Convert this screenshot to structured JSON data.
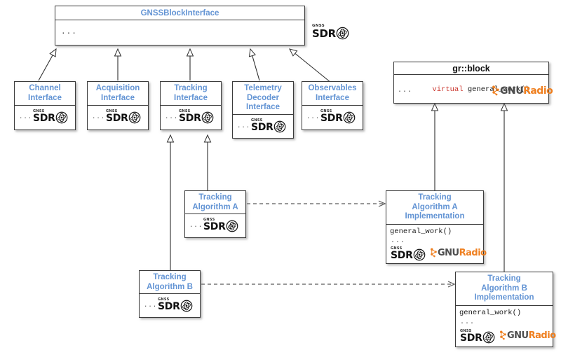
{
  "diagram": {
    "title_color": "#6394d4",
    "keyword_color": "#cc3b33",
    "gnuradio_accent": "#ef7f1f",
    "background": "#ffffff"
  },
  "logos": {
    "gnss_sdr": {
      "top_text": "GNSS",
      "main_text": "SDR",
      "name": "gnss-sdr-logo"
    },
    "gnuradio": {
      "part1": "GNU",
      "part2": "Radio",
      "name": "gnuradio-logo"
    }
  },
  "nodes": {
    "gnss_block_interface": {
      "title": "GNSSBlockInterface",
      "body_dots": "..."
    },
    "channel_interface": {
      "title": "Channel\nInterface",
      "body_dots": "..."
    },
    "acquisition_interface": {
      "title": "Acquisition\nInterface",
      "body_dots": "..."
    },
    "tracking_interface": {
      "title": "Tracking\nInterface",
      "body_dots": "..."
    },
    "telemetry_decoder_interface": {
      "title": "Telemetry\nDecoder\nInterface",
      "body_dots": "..."
    },
    "observables_interface": {
      "title": "Observables\nInterface",
      "body_dots": "..."
    },
    "gr_block": {
      "title": "gr::block",
      "method_keyword": "virtual",
      "method_name": " general_work()",
      "body_dots": "..."
    },
    "tracking_algorithm_a": {
      "title": "Tracking\nAlgorithm A",
      "body_dots": "..."
    },
    "tracking_algorithm_b": {
      "title": "Tracking\nAlgorithm B",
      "body_dots": "..."
    },
    "tracking_algorithm_a_impl": {
      "title": "Tracking\nAlgorithm A\nImplementation",
      "method": "general_work()",
      "body_dots": "..."
    },
    "tracking_algorithm_b_impl": {
      "title": "Tracking\nAlgorithm B\nImplementation",
      "method": "general_work()",
      "body_dots": "..."
    }
  },
  "edges": [
    {
      "name": "channel-interface-generalization",
      "type": "generalization",
      "from": "channel_interface",
      "to": "gnss_block_interface"
    },
    {
      "name": "acquisition-interface-generalization",
      "type": "generalization",
      "from": "acquisition_interface",
      "to": "gnss_block_interface"
    },
    {
      "name": "tracking-interface-generalization",
      "type": "generalization",
      "from": "tracking_interface",
      "to": "gnss_block_interface"
    },
    {
      "name": "telemetry-decoder-interface-generalization",
      "type": "generalization",
      "from": "telemetry_decoder_interface",
      "to": "gnss_block_interface"
    },
    {
      "name": "observables-interface-generalization",
      "type": "generalization",
      "from": "observables_interface",
      "to": "gnss_block_interface"
    },
    {
      "name": "tracking-algorithm-a-generalization",
      "type": "generalization",
      "from": "tracking_algorithm_a",
      "to": "tracking_interface"
    },
    {
      "name": "tracking-algorithm-b-generalization",
      "type": "generalization",
      "from": "tracking_algorithm_b",
      "to": "tracking_interface"
    },
    {
      "name": "tracking-algorithm-a-impl-generalization",
      "type": "generalization",
      "from": "tracking_algorithm_a_impl",
      "to": "gr_block"
    },
    {
      "name": "tracking-algorithm-b-impl-generalization",
      "type": "generalization",
      "from": "tracking_algorithm_b_impl",
      "to": "gr_block"
    },
    {
      "name": "tracking-algorithm-a-realization",
      "type": "dependency",
      "from": "tracking_algorithm_a",
      "to": "tracking_algorithm_a_impl"
    },
    {
      "name": "tracking-algorithm-b-realization",
      "type": "dependency",
      "from": "tracking_algorithm_b",
      "to": "tracking_algorithm_b_impl"
    }
  ]
}
